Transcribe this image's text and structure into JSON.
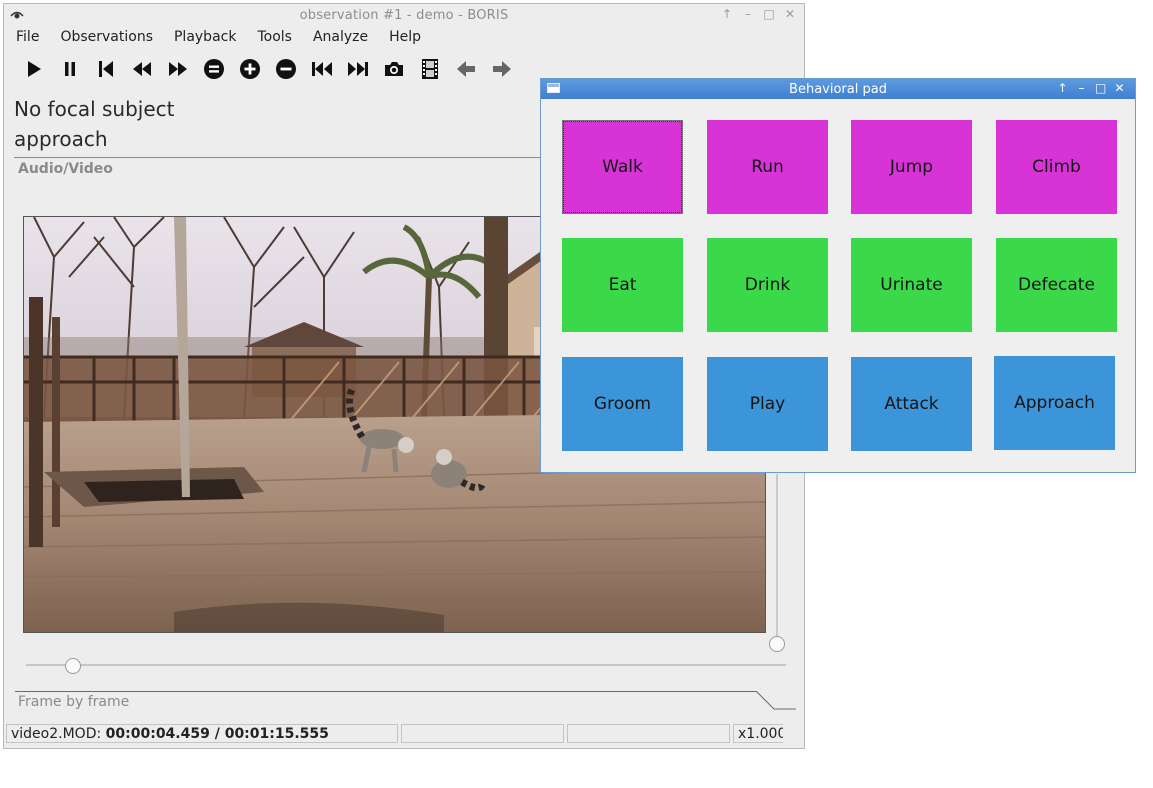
{
  "main_window": {
    "title": "observation #1 - demo - BORIS",
    "menu": [
      "File",
      "Observations",
      "Playback",
      "Tools",
      "Analyze",
      "Help"
    ],
    "toolbar_icons": [
      "play-icon",
      "pause-icon",
      "previous-media-icon",
      "rewind-icon",
      "fast-forward-icon",
      "reset-speed-icon",
      "speed-up-icon",
      "slow-down-icon",
      "jump-backward-icon",
      "jump-forward-icon",
      "snapshot-icon",
      "frame-by-frame-icon",
      "previous-frame-icon",
      "next-frame-icon"
    ],
    "focal_subject": "No focal subject",
    "current_behavior": "approach",
    "av_label": "Audio/Video",
    "frame_by_frame_label": "Frame by frame",
    "status": {
      "file": "video2.MOD: ",
      "time": "00:00:04.459 / 00:01:15.555",
      "field2": "",
      "field3": "",
      "speed": "x1.000"
    },
    "video_position": 0.06,
    "volume_level": 0.0
  },
  "pad": {
    "title": "Behavioral pad",
    "buttons": [
      {
        "label": "Walk",
        "color": "#d733d7"
      },
      {
        "label": "Run",
        "color": "#d733d7"
      },
      {
        "label": "Jump",
        "color": "#d733d7"
      },
      {
        "label": "Climb",
        "color": "#d733d7"
      },
      {
        "label": "Eat",
        "color": "#3bd94a"
      },
      {
        "label": "Drink",
        "color": "#3bd94a"
      },
      {
        "label": "Urinate",
        "color": "#3bd94a"
      },
      {
        "label": "Defecate",
        "color": "#3bd94a"
      },
      {
        "label": "Groom",
        "color": "#3b95d8"
      },
      {
        "label": "Play",
        "color": "#3b95d8"
      },
      {
        "label": "Attack",
        "color": "#3b95d8"
      },
      {
        "label": "Approach",
        "color": "#3b95d8"
      }
    ]
  }
}
